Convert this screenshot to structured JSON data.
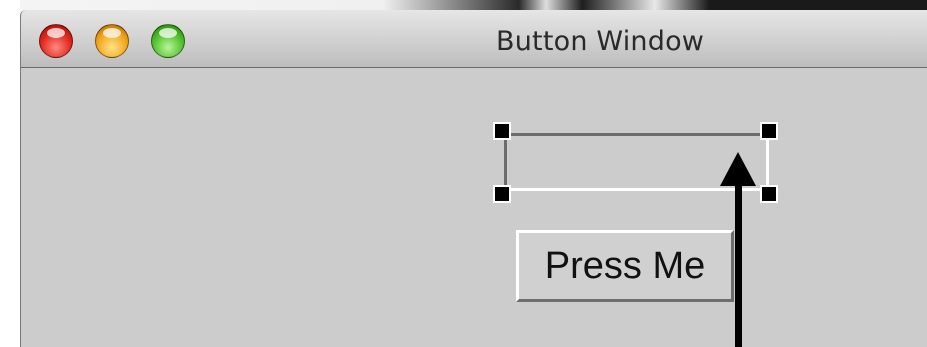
{
  "window": {
    "title": "Button Window",
    "controls": {
      "close": "close-button",
      "minimize": "minimize-button",
      "zoom": "zoom-button"
    }
  },
  "content": {
    "text_field": {
      "value": "",
      "selected": true
    },
    "button": {
      "label": "Press Me"
    },
    "annotation": {
      "type": "arrow",
      "points_to": "text_field"
    }
  },
  "colors": {
    "window_background": "#cccccc",
    "close": "#e0261c",
    "minimize": "#f2a51a",
    "zoom": "#4fbf2a"
  }
}
